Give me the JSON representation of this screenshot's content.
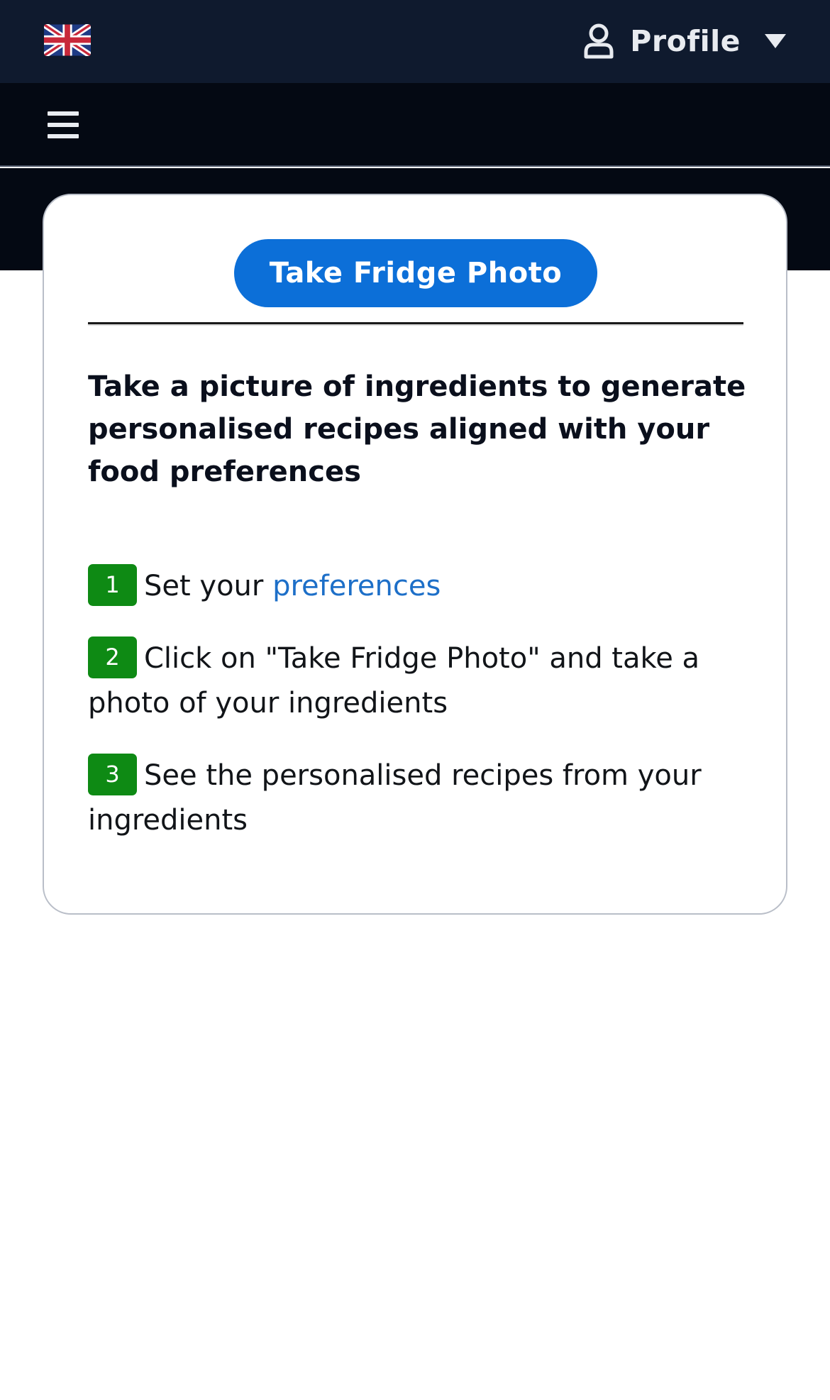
{
  "header": {
    "language_flag": "uk-flag-icon",
    "profile_label": "Profile"
  },
  "card": {
    "cta_label": "Take Fridge Photo",
    "intro": "Take a picture of ingredients to generate personalised recipes aligned with your food preferences",
    "steps": [
      {
        "number": "1",
        "text_before": "Set your ",
        "link": "preferences"
      },
      {
        "number": "2",
        "text": "Click on \"Take Fridge Photo\" and take a photo of your ingredients"
      },
      {
        "number": "3",
        "text": "See the personalised recipes from your ingredients"
      }
    ]
  },
  "colors": {
    "top_bar": "#0f1a2e",
    "nav_bar": "#040913",
    "accent": "#0c6fd8",
    "step_badge": "#0e8a14",
    "link": "#1d6fc8"
  }
}
